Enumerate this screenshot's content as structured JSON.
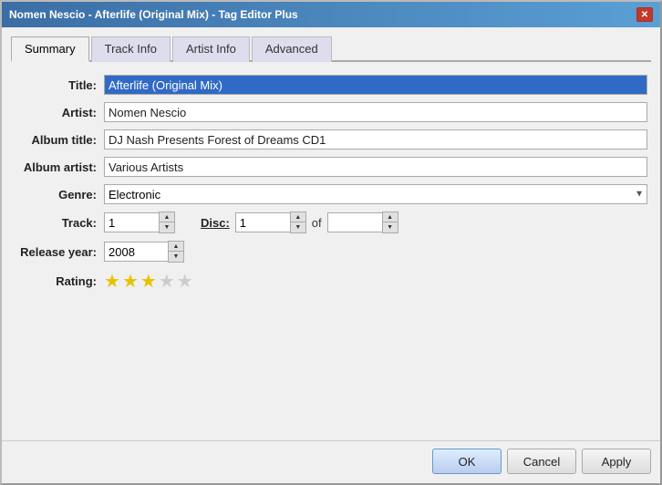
{
  "window": {
    "title": "Nomen Nescio - Afterlife (Original Mix) - Tag Editor Plus",
    "close_label": "✕"
  },
  "tabs": [
    {
      "id": "summary",
      "label": "Summary",
      "active": true
    },
    {
      "id": "track-info",
      "label": "Track Info",
      "active": false
    },
    {
      "id": "artist-info",
      "label": "Artist Info",
      "active": false
    },
    {
      "id": "advanced",
      "label": "Advanced",
      "active": false
    }
  ],
  "form": {
    "title_label": "Title:",
    "title_value": "Afterlife (Original Mix)",
    "artist_label": "Artist:",
    "artist_value": "Nomen Nescio",
    "album_title_label": "Album title:",
    "album_title_value": "DJ Nash Presents Forest of Dreams CD1",
    "album_artist_label": "Album artist:",
    "album_artist_value": "Various Artists",
    "genre_label": "Genre:",
    "genre_value": "Electronic",
    "track_label": "Track:",
    "track_value": "1",
    "disc_label": "Disc:",
    "disc_value": "1",
    "disc_of_label": "of",
    "disc_of_value": "",
    "release_year_label": "Release year:",
    "release_year_value": "2008",
    "rating_label": "Rating:",
    "stars": [
      {
        "filled": true
      },
      {
        "filled": true
      },
      {
        "filled": true
      },
      {
        "filled": false
      },
      {
        "filled": false
      }
    ]
  },
  "buttons": {
    "ok_label": "OK",
    "cancel_label": "Cancel",
    "apply_label": "Apply"
  }
}
